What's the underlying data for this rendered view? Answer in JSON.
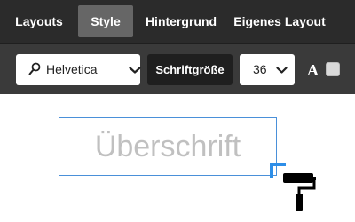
{
  "tabs": [
    {
      "label": "Layouts",
      "active": false
    },
    {
      "label": "Style",
      "active": true
    },
    {
      "label": "Hintergrund",
      "active": false
    },
    {
      "label": "Eigenes Layout",
      "active": false
    }
  ],
  "toolbar": {
    "font": {
      "value": "Helvetica",
      "icon": "search-icon"
    },
    "size_label": "Schriftgröße",
    "size": {
      "value": "36"
    },
    "text_color_glyph": "A",
    "swatch_color": "#d9d9d9"
  },
  "canvas": {
    "heading_placeholder": "Überschrift",
    "selection_color": "#4a90d9",
    "tool_icon": "paint-roller-icon"
  }
}
